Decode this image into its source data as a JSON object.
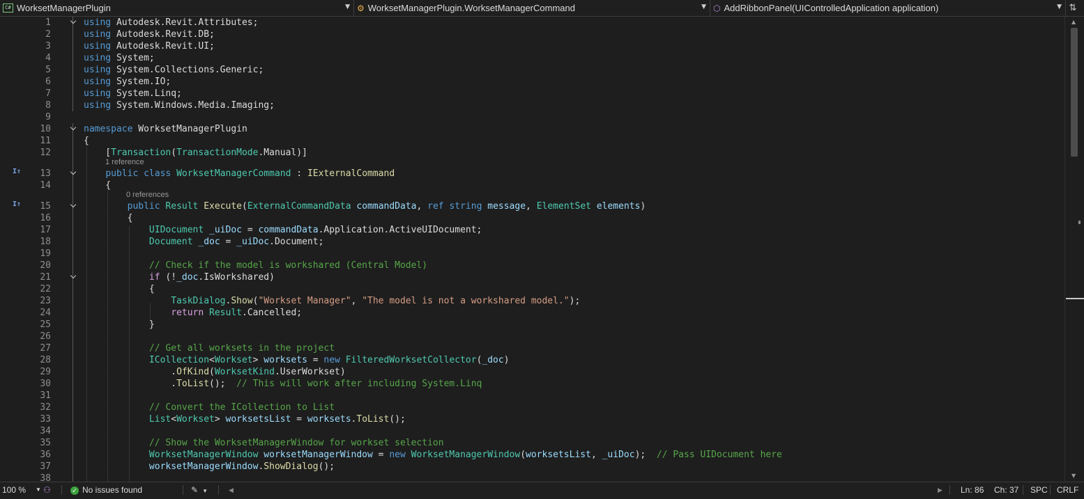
{
  "navbar": {
    "project_dropdown": {
      "label": "WorksetManagerPlugin",
      "icon": "csharp-project-icon"
    },
    "type_dropdown": {
      "label": "WorksetManagerPlugin.WorksetManagerCommand",
      "icon": "class-icon"
    },
    "member_dropdown": {
      "label": "AddRibbonPanel(UIControlledApplication application)",
      "icon": "method-icon"
    }
  },
  "code_lens": {
    "line13": "1 reference",
    "line15": "0 references"
  },
  "code_lines": [
    {
      "n": "1",
      "tokens": [
        {
          "c": "k",
          "t": "using"
        },
        {
          "c": "",
          "t": " Autodesk.Revit.Attributes;"
        }
      ]
    },
    {
      "n": "2",
      "tokens": [
        {
          "c": "k",
          "t": "using"
        },
        {
          "c": "",
          "t": " Autodesk.Revit.DB;"
        }
      ]
    },
    {
      "n": "3",
      "tokens": [
        {
          "c": "k",
          "t": "using"
        },
        {
          "c": "",
          "t": " Autodesk.Revit.UI;"
        }
      ]
    },
    {
      "n": "4",
      "tokens": [
        {
          "c": "k",
          "t": "using"
        },
        {
          "c": "",
          "t": " System;"
        }
      ]
    },
    {
      "n": "5",
      "tokens": [
        {
          "c": "k",
          "t": "using"
        },
        {
          "c": "",
          "t": " System.Collections.Generic;"
        }
      ]
    },
    {
      "n": "6",
      "tokens": [
        {
          "c": "k",
          "t": "using"
        },
        {
          "c": "",
          "t": " System.IO;"
        }
      ]
    },
    {
      "n": "7",
      "tokens": [
        {
          "c": "k",
          "t": "using"
        },
        {
          "c": "",
          "t": " System.Linq;"
        }
      ]
    },
    {
      "n": "8",
      "tokens": [
        {
          "c": "k",
          "t": "using"
        },
        {
          "c": "",
          "t": " System.Windows.Media.Imaging;"
        }
      ]
    },
    {
      "n": "9",
      "tokens": []
    },
    {
      "n": "10",
      "tokens": [
        {
          "c": "k",
          "t": "namespace"
        },
        {
          "c": "",
          "t": " WorksetManagerPlugin"
        }
      ]
    },
    {
      "n": "11",
      "tokens": [
        {
          "c": "",
          "t": "{"
        }
      ]
    },
    {
      "n": "12",
      "tokens": [
        {
          "c": "",
          "t": "    ["
        },
        {
          "c": "t",
          "t": "Transaction"
        },
        {
          "c": "",
          "t": "("
        },
        {
          "c": "t",
          "t": "TransactionMode"
        },
        {
          "c": "",
          "t": ".Manual)]"
        }
      ]
    },
    {
      "n": "13",
      "tokens": [
        {
          "c": "",
          "t": "    "
        },
        {
          "c": "k",
          "t": "public"
        },
        {
          "c": "",
          "t": " "
        },
        {
          "c": "k",
          "t": "class"
        },
        {
          "c": "",
          "t": " "
        },
        {
          "c": "t",
          "t": "WorksetManagerCommand"
        },
        {
          "c": "",
          "t": " : "
        },
        {
          "c": "m",
          "t": "IExternalCommand"
        }
      ]
    },
    {
      "n": "14",
      "tokens": [
        {
          "c": "",
          "t": "    {"
        }
      ]
    },
    {
      "n": "15",
      "tokens": [
        {
          "c": "",
          "t": "        "
        },
        {
          "c": "k",
          "t": "public"
        },
        {
          "c": "",
          "t": " "
        },
        {
          "c": "t",
          "t": "Result"
        },
        {
          "c": "",
          "t": " "
        },
        {
          "c": "m",
          "t": "Execute"
        },
        {
          "c": "",
          "t": "("
        },
        {
          "c": "t",
          "t": "ExternalCommandData"
        },
        {
          "c": "",
          "t": " "
        },
        {
          "c": "p",
          "t": "commandData"
        },
        {
          "c": "",
          "t": ", "
        },
        {
          "c": "k",
          "t": "ref"
        },
        {
          "c": "",
          "t": " "
        },
        {
          "c": "k",
          "t": "string"
        },
        {
          "c": "",
          "t": " "
        },
        {
          "c": "p",
          "t": "message"
        },
        {
          "c": "",
          "t": ", "
        },
        {
          "c": "t",
          "t": "ElementSet"
        },
        {
          "c": "",
          "t": " "
        },
        {
          "c": "p",
          "t": "elements"
        },
        {
          "c": "",
          "t": ")"
        }
      ]
    },
    {
      "n": "16",
      "tokens": [
        {
          "c": "",
          "t": "        {"
        }
      ]
    },
    {
      "n": "17",
      "tokens": [
        {
          "c": "",
          "t": "            "
        },
        {
          "c": "t",
          "t": "UIDocument"
        },
        {
          "c": "",
          "t": " "
        },
        {
          "c": "p",
          "t": "_uiDoc"
        },
        {
          "c": "",
          "t": " = "
        },
        {
          "c": "p",
          "t": "commandData"
        },
        {
          "c": "",
          "t": ".Application.ActiveUIDocument;"
        }
      ]
    },
    {
      "n": "18",
      "tokens": [
        {
          "c": "",
          "t": "            "
        },
        {
          "c": "t",
          "t": "Document"
        },
        {
          "c": "",
          "t": " "
        },
        {
          "c": "p",
          "t": "_doc"
        },
        {
          "c": "",
          "t": " = "
        },
        {
          "c": "p",
          "t": "_uiDoc"
        },
        {
          "c": "",
          "t": ".Document;"
        }
      ]
    },
    {
      "n": "19",
      "tokens": []
    },
    {
      "n": "20",
      "tokens": [
        {
          "c": "",
          "t": "            "
        },
        {
          "c": "c",
          "t": "// Check if the model is workshared (Central Model)"
        }
      ]
    },
    {
      "n": "21",
      "tokens": [
        {
          "c": "",
          "t": "            "
        },
        {
          "c": "ctl",
          "t": "if"
        },
        {
          "c": "",
          "t": " (!"
        },
        {
          "c": "p",
          "t": "_doc"
        },
        {
          "c": "",
          "t": ".IsWorkshared)"
        }
      ]
    },
    {
      "n": "22",
      "tokens": [
        {
          "c": "",
          "t": "            {"
        }
      ]
    },
    {
      "n": "23",
      "tokens": [
        {
          "c": "",
          "t": "                "
        },
        {
          "c": "t",
          "t": "TaskDialog"
        },
        {
          "c": "",
          "t": "."
        },
        {
          "c": "m",
          "t": "Show"
        },
        {
          "c": "",
          "t": "("
        },
        {
          "c": "s",
          "t": "\"Workset Manager\""
        },
        {
          "c": "",
          "t": ", "
        },
        {
          "c": "s",
          "t": "\"The model is not a workshared model.\""
        },
        {
          "c": "",
          "t": ");"
        }
      ]
    },
    {
      "n": "24",
      "tokens": [
        {
          "c": "",
          "t": "                "
        },
        {
          "c": "ctl",
          "t": "return"
        },
        {
          "c": "",
          "t": " "
        },
        {
          "c": "t",
          "t": "Result"
        },
        {
          "c": "",
          "t": ".Cancelled;"
        }
      ]
    },
    {
      "n": "25",
      "tokens": [
        {
          "c": "",
          "t": "            }"
        }
      ]
    },
    {
      "n": "26",
      "tokens": []
    },
    {
      "n": "27",
      "tokens": [
        {
          "c": "",
          "t": "            "
        },
        {
          "c": "c",
          "t": "// Get all worksets in the project"
        }
      ]
    },
    {
      "n": "28",
      "tokens": [
        {
          "c": "",
          "t": "            "
        },
        {
          "c": "t",
          "t": "ICollection"
        },
        {
          "c": "",
          "t": "<"
        },
        {
          "c": "t",
          "t": "Workset"
        },
        {
          "c": "",
          "t": "> "
        },
        {
          "c": "p",
          "t": "worksets"
        },
        {
          "c": "",
          "t": " = "
        },
        {
          "c": "k",
          "t": "new"
        },
        {
          "c": "",
          "t": " "
        },
        {
          "c": "t",
          "t": "FilteredWorksetCollector"
        },
        {
          "c": "",
          "t": "("
        },
        {
          "c": "p",
          "t": "_doc"
        },
        {
          "c": "",
          "t": ")"
        }
      ]
    },
    {
      "n": "29",
      "tokens": [
        {
          "c": "",
          "t": "                ."
        },
        {
          "c": "m",
          "t": "OfKind"
        },
        {
          "c": "",
          "t": "("
        },
        {
          "c": "t",
          "t": "WorksetKind"
        },
        {
          "c": "",
          "t": ".UserWorkset)"
        }
      ]
    },
    {
      "n": "30",
      "tokens": [
        {
          "c": "",
          "t": "                ."
        },
        {
          "c": "m",
          "t": "ToList"
        },
        {
          "c": "",
          "t": "();  "
        },
        {
          "c": "c",
          "t": "// This will work after including System.Linq"
        }
      ]
    },
    {
      "n": "31",
      "tokens": []
    },
    {
      "n": "32",
      "tokens": [
        {
          "c": "",
          "t": "            "
        },
        {
          "c": "c",
          "t": "// Convert the ICollection to List"
        }
      ]
    },
    {
      "n": "33",
      "tokens": [
        {
          "c": "",
          "t": "            "
        },
        {
          "c": "t",
          "t": "List"
        },
        {
          "c": "",
          "t": "<"
        },
        {
          "c": "t",
          "t": "Workset"
        },
        {
          "c": "",
          "t": "> "
        },
        {
          "c": "p",
          "t": "worksetsList"
        },
        {
          "c": "",
          "t": " = "
        },
        {
          "c": "p",
          "t": "worksets"
        },
        {
          "c": "",
          "t": "."
        },
        {
          "c": "m",
          "t": "ToList"
        },
        {
          "c": "",
          "t": "();"
        }
      ]
    },
    {
      "n": "34",
      "tokens": []
    },
    {
      "n": "35",
      "tokens": [
        {
          "c": "",
          "t": "            "
        },
        {
          "c": "c",
          "t": "// Show the WorksetManagerWindow for workset selection"
        }
      ]
    },
    {
      "n": "36",
      "tokens": [
        {
          "c": "",
          "t": "            "
        },
        {
          "c": "t",
          "t": "WorksetManagerWindow"
        },
        {
          "c": "",
          "t": " "
        },
        {
          "c": "p",
          "t": "worksetManagerWindow"
        },
        {
          "c": "",
          "t": " = "
        },
        {
          "c": "k",
          "t": "new"
        },
        {
          "c": "",
          "t": " "
        },
        {
          "c": "t",
          "t": "WorksetManagerWindow"
        },
        {
          "c": "",
          "t": "("
        },
        {
          "c": "p",
          "t": "worksetsList"
        },
        {
          "c": "",
          "t": ", "
        },
        {
          "c": "p",
          "t": "_uiDoc"
        },
        {
          "c": "",
          "t": ");  "
        },
        {
          "c": "c",
          "t": "// Pass UIDocument here"
        }
      ]
    },
    {
      "n": "37",
      "tokens": [
        {
          "c": "",
          "t": "            "
        },
        {
          "c": "p",
          "t": "worksetManagerWindow"
        },
        {
          "c": "",
          "t": "."
        },
        {
          "c": "m",
          "t": "ShowDialog"
        },
        {
          "c": "",
          "t": "();"
        }
      ]
    },
    {
      "n": "38",
      "tokens": []
    }
  ],
  "statusbar": {
    "zoom": "100 %",
    "issues": "No issues found",
    "line": "Ln: 86",
    "col": "Ch: 37",
    "whitespace": "SPC",
    "line_ending": "CRLF"
  },
  "colors": {
    "keyword": "#569cd6",
    "type": "#4ec9b0",
    "method": "#dcdcaa",
    "identifier": "#9cdcfe",
    "string": "#d69d85",
    "comment": "#57a64a",
    "control": "#d8a0df"
  }
}
